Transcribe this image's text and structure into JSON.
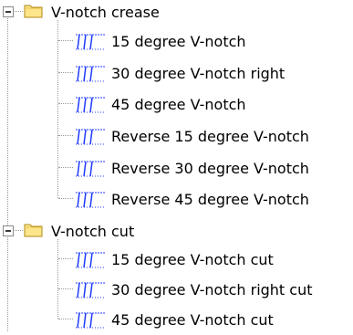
{
  "tree": {
    "groups": [
      {
        "label": "V-notch crease",
        "expanded": true,
        "icon": "folder-icon",
        "items": [
          {
            "label": "15 degree V-notch",
            "icon": "v-notch-icon"
          },
          {
            "label": "30 degree V-notch right",
            "icon": "v-notch-icon"
          },
          {
            "label": "45 degree V-notch",
            "icon": "v-notch-icon"
          },
          {
            "label": "Reverse 15 degree V-notch",
            "icon": "v-notch-icon"
          },
          {
            "label": "Reverse 30 degree V-notch",
            "icon": "v-notch-icon"
          },
          {
            "label": "Reverse 45 degree V-notch",
            "icon": "v-notch-icon"
          }
        ]
      },
      {
        "label": "V-notch cut",
        "expanded": true,
        "icon": "folder-icon",
        "items": [
          {
            "label": "15 degree V-notch cut",
            "icon": "v-notch-icon"
          },
          {
            "label": "30 degree V-notch right cut",
            "icon": "v-notch-icon"
          },
          {
            "label": "45 degree V-notch cut",
            "icon": "v-notch-icon"
          }
        ]
      }
    ],
    "colors": {
      "folder_fill": "#fde58a",
      "folder_stroke": "#b08a1a",
      "icon_blue": "#1f3bff",
      "connector": "#9a9a9a"
    }
  }
}
